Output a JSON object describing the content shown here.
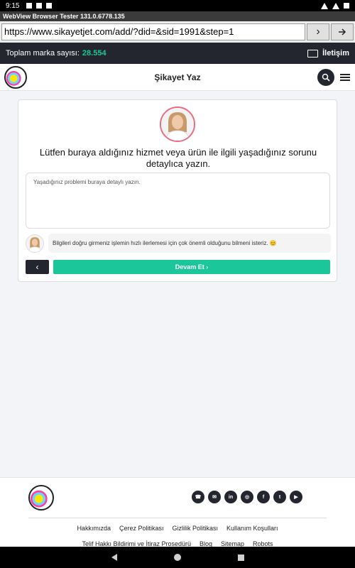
{
  "status": {
    "time": "9:15"
  },
  "app": {
    "title": "WebView Browser Tester 131.0.6778.135"
  },
  "browser": {
    "url": "https://www.sikayetjet.com/add/?did=&sid=1991&step=1",
    "go_label": "›"
  },
  "topbar": {
    "brand_count_label": "Toplam marka sayısı:",
    "brand_count": "28.554",
    "contact_label": "İletişim"
  },
  "header": {
    "title": "Şikayet Yaz"
  },
  "form": {
    "question": "Lütfen buraya aldığınız hizmet veya ürün ile ilgili yaşadığınız sorunu detaylıca yazın.",
    "placeholder": "Yaşadığınız problemi buraya detaylı yazın.",
    "hint": "Bilgileri doğru girmeniz işlemin hızlı ilerlemesi için çok önemli olduğunu bilmeni isteriz. 😊",
    "back_label": "‹",
    "next_label": "Devam Et ›"
  },
  "footer": {
    "socials": [
      "phone-icon",
      "mail-icon",
      "linkedin-icon",
      "instagram-icon",
      "facebook-icon",
      "twitter-icon",
      "youtube-icon"
    ],
    "links_row1": [
      "Hakkımızda",
      "Çerez Politikası",
      "Gizlilik Politikası",
      "Kullanım Koşulları"
    ],
    "links_row2": [
      "Telif Hakkı Bildirimi ve İtiraz Prosedürü",
      "Blog",
      "Sitemap",
      "Robots"
    ]
  },
  "colors": {
    "accent": "#1bc79a",
    "dark": "#23262e",
    "avatar_border": "#e96b84"
  }
}
